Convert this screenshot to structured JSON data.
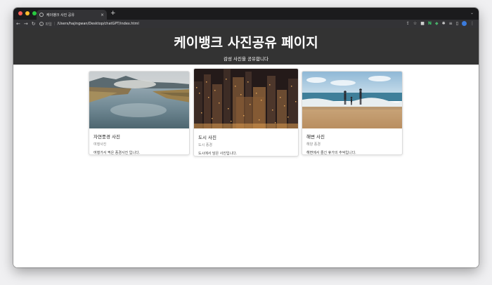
{
  "browser": {
    "tab_title": "케이뱅크 사진 공유",
    "tab_close": "×",
    "new_tab": "+",
    "tab_menu": "⌄",
    "url_scheme": "파일",
    "url_separator": "|",
    "url": "/Users/hajingwan/Desktop/chatGPT/index.html",
    "extension_n": "N",
    "icons": [
      "back-icon",
      "forward-icon",
      "reload-icon",
      "info-icon",
      "share-icon",
      "star-icon",
      "extension-icon",
      "n-extension-icon",
      "green-extension-icon",
      "puzzle-icon",
      "reading-list-icon",
      "side-panel-icon",
      "profile-avatar",
      "more-icon"
    ]
  },
  "header": {
    "title": "케이뱅크 사진공유 페이지",
    "subtitle": "감성 사진을 공유합니다"
  },
  "cards": [
    {
      "title": "자연풍경 사진",
      "subtitle": "여행사진",
      "text": "여행가서 찍은 풍경사진 입니다."
    },
    {
      "title": "도시 사진",
      "subtitle": "도시 풍경",
      "text": "도시에서 담은 사진입니다."
    },
    {
      "title": "해변 사진",
      "subtitle": "해양 풍경",
      "text": "해변에서 즐긴 휴가의 추억입니다."
    }
  ],
  "colors": {
    "tabstrip": "#1b1b1d",
    "toolbar": "#333336",
    "header_bg": "#333333",
    "page_bg": "#ffffff"
  }
}
